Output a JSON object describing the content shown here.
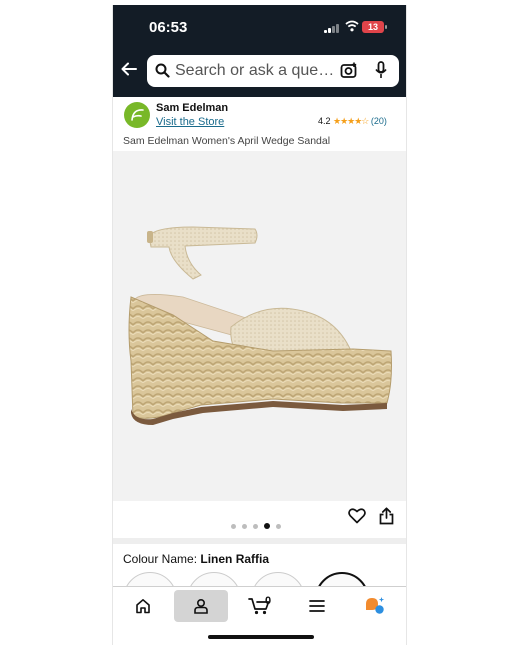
{
  "status_bar": {
    "time": "06:53",
    "battery": "13"
  },
  "search": {
    "placeholder": "Search or ask a que…"
  },
  "store": {
    "brand": "Sam Edelman",
    "visit_label": "Visit the Store",
    "rating": "4.2",
    "stars": "★★★★☆",
    "review_count": "(20)"
  },
  "product": {
    "title": "Sam Edelman Women's April Wedge Sandal"
  },
  "gallery": {
    "dot_count": 5,
    "active_index": 3
  },
  "colour": {
    "label": "Colour Name:",
    "value": "Linen Raffia"
  },
  "tabbar": {
    "active": "account",
    "cart_count": "0"
  },
  "colors": {
    "header_bg": "#131c26",
    "link": "#1a6b8c",
    "star": "#f59f1a"
  }
}
